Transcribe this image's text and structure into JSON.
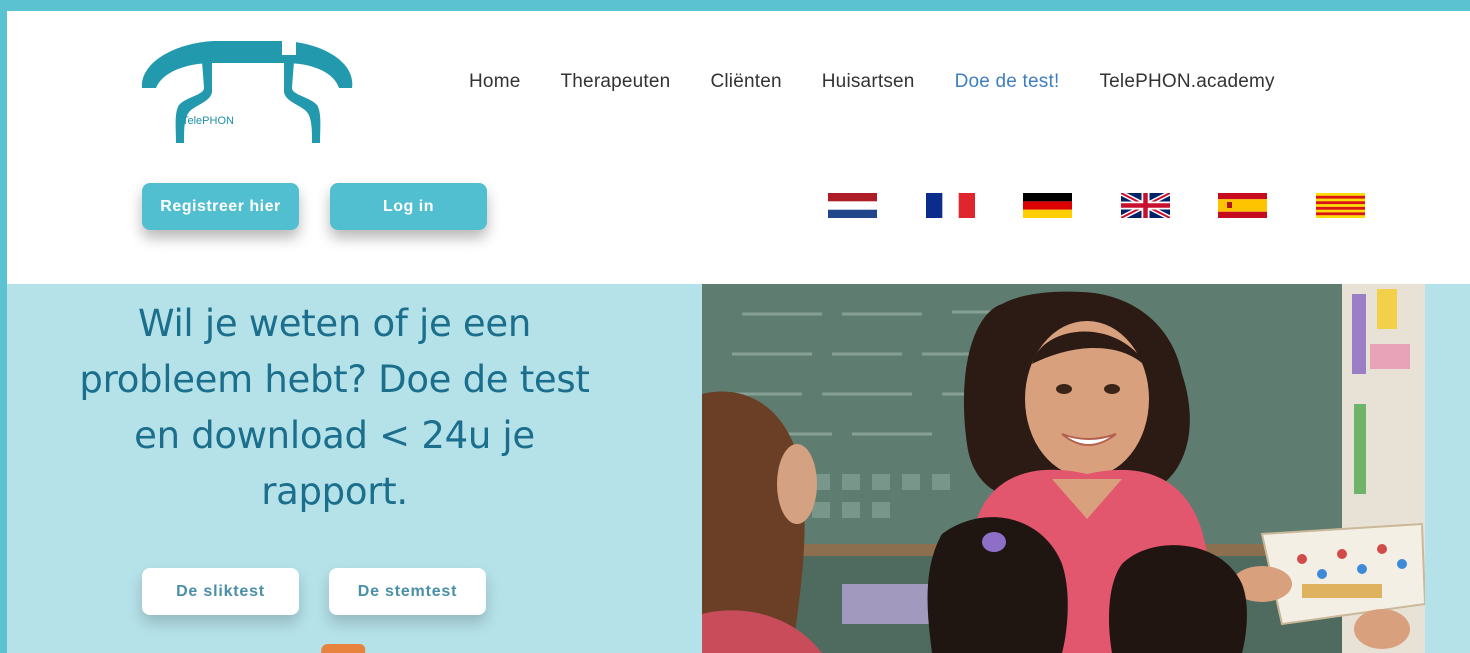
{
  "brand": {
    "logo_text": "TelePHON"
  },
  "nav": {
    "items": [
      {
        "label": "Home"
      },
      {
        "label": "Therapeuten"
      },
      {
        "label": "Cliënten"
      },
      {
        "label": "Huisartsen"
      },
      {
        "label": "Doe de test!"
      },
      {
        "label": "TelePHON.academy"
      }
    ],
    "active_index": 4
  },
  "header_buttons": {
    "register_label": "Registreer hier",
    "login_label": "Log in"
  },
  "languages": [
    "dutch-flag",
    "french-flag",
    "german-flag",
    "uk-flag",
    "spanish-flag",
    "catalan-flag"
  ],
  "hero": {
    "title": "Wil je weten of je een probleem hebt? Doe de test en download < 24u je rapport.",
    "buttons": [
      {
        "label": "De sliktest"
      },
      {
        "label": "De stemtest"
      }
    ],
    "image_name": "teacher-with-children-photo"
  },
  "colors": {
    "accent": "#52bfd0",
    "frame": "#5bc2d2",
    "hero_bg": "#b5e1e9",
    "title": "#1b6f8c",
    "active_nav": "#3f7ec0"
  }
}
